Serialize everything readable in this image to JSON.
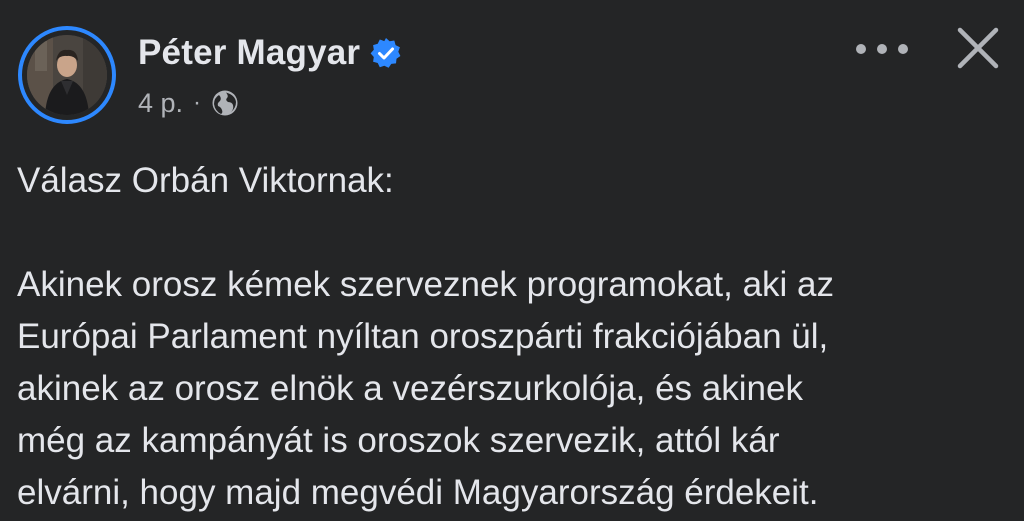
{
  "post": {
    "author": "Péter Magyar",
    "verified": true,
    "time": "4 p.",
    "separator": "·",
    "privacy_icon": "globe-icon",
    "more_icon": "more-horizontal-icon",
    "close_icon": "close-icon",
    "body": {
      "title_line": "Válasz Orbán Viktornak:",
      "lines": [
        "Akinek orosz kémek szerveznek programokat, aki az",
        "Európai Parlament nyíltan oroszpárti frakciójában ül,",
        "akinek az orosz elnök a vezérszurkolója, és akinek",
        "még az kampányát is oroszok szervezik, attól kár",
        "elvárni, hogy majd megvédi Magyarország érdekeit."
      ]
    }
  },
  "colors": {
    "background": "#242526",
    "text_primary": "#e4e6eb",
    "text_secondary": "#b0b3b8",
    "accent_blue": "#2d88ff"
  }
}
